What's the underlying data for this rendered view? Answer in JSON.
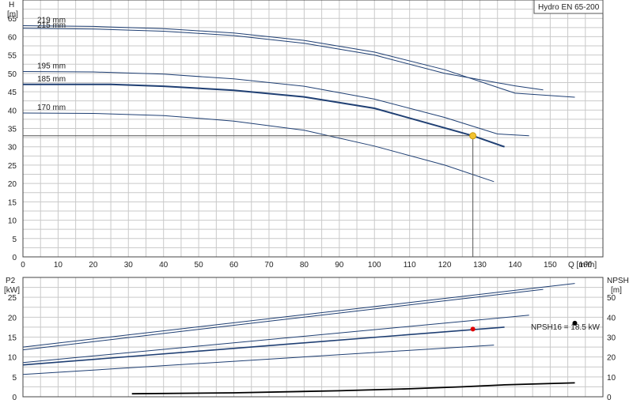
{
  "title": "Hydro EN 65-200",
  "colors": {
    "curve": "#1f3f73",
    "grid": "#c9c9c9",
    "duty": "#f2c230",
    "p2_point": "#e00000",
    "npsh_point": "#000000"
  },
  "chart_data": [
    {
      "type": "line",
      "name": "head-curves",
      "xlabel": "Q [m³/h]",
      "ylabel": "H",
      "ylabel_unit": "[m]",
      "xlim": [
        0,
        165
      ],
      "ylim": [
        0,
        70
      ],
      "xticks": [
        0,
        10,
        20,
        30,
        40,
        50,
        60,
        70,
        80,
        90,
        100,
        110,
        120,
        130,
        140,
        150,
        160
      ],
      "yticks": [
        0,
        5,
        10,
        15,
        20,
        25,
        30,
        35,
        40,
        45,
        50,
        55,
        60,
        65
      ],
      "grid": true,
      "series": [
        {
          "name": "219 mm",
          "label": "219 mm",
          "x": [
            0,
            20,
            40,
            60,
            80,
            100,
            120,
            140,
            157
          ],
          "y": [
            63,
            62.8,
            62.2,
            61,
            59,
            55.8,
            51,
            44.6,
            43.5
          ]
        },
        {
          "name": "215 mm",
          "label": "215 mm",
          "x": [
            0,
            20,
            40,
            60,
            80,
            100,
            120,
            140,
            148
          ],
          "y": [
            62.3,
            62.1,
            61.5,
            60.3,
            58.2,
            55,
            50,
            46.6,
            45.5
          ]
        },
        {
          "name": "195 mm",
          "label": "195 mm",
          "x": [
            0,
            20,
            40,
            60,
            80,
            100,
            120,
            135,
            144
          ],
          "y": [
            50.5,
            50.4,
            49.8,
            48.5,
            46.5,
            43,
            38,
            33.5,
            33
          ]
        },
        {
          "name": "185 mm",
          "label": "185 mm",
          "x": [
            0,
            25,
            40,
            60,
            80,
            100,
            128,
            137
          ],
          "y": [
            47,
            47,
            46.5,
            45.4,
            43.6,
            40.5,
            33,
            30
          ]
        },
        {
          "name": "170 mm",
          "label": "170 mm",
          "x": [
            0,
            20,
            40,
            60,
            80,
            100,
            120,
            134
          ],
          "y": [
            39.2,
            39.1,
            38.5,
            37,
            34.5,
            30.2,
            25,
            20.5
          ]
        }
      ],
      "duty_point": {
        "x": 128,
        "y": 33
      }
    },
    {
      "type": "line",
      "name": "power-npsh-curves",
      "ylabel": "P2",
      "ylabel_unit": "[kW]",
      "ylabel_right": "NPSH",
      "ylabel_right_unit": "[m]",
      "xlim": [
        0,
        165
      ],
      "ylim": [
        0,
        30
      ],
      "ylim_right": [
        0,
        60
      ],
      "yticks": [
        0,
        5,
        10,
        15,
        20,
        25
      ],
      "yticks_right": [
        0,
        10,
        20,
        30,
        40,
        50
      ],
      "grid": true,
      "series": [
        {
          "name": "219 mm",
          "x": [
            0,
            157
          ],
          "y": [
            12.5,
            28.5
          ]
        },
        {
          "name": "215 mm",
          "x": [
            0,
            148
          ],
          "y": [
            11.8,
            27
          ]
        },
        {
          "name": "195 mm",
          "x": [
            0,
            144
          ],
          "y": [
            8.6,
            20.5
          ]
        },
        {
          "name": "185 mm",
          "x": [
            0,
            137
          ],
          "y": [
            8,
            17.5
          ]
        },
        {
          "name": "170 mm",
          "x": [
            0,
            134
          ],
          "y": [
            5.6,
            13
          ]
        }
      ],
      "npsh_series": {
        "x": [
          31,
          60,
          90,
          110,
          125,
          137,
          157
        ],
        "y": [
          1.5,
          2,
          3,
          4,
          5,
          6,
          7
        ]
      },
      "power_point": {
        "x": 128,
        "y": 17
      },
      "npsh_point": {
        "x": 157,
        "y": 37
      },
      "annotation": "NPSH16 = 18.5 kW"
    }
  ]
}
